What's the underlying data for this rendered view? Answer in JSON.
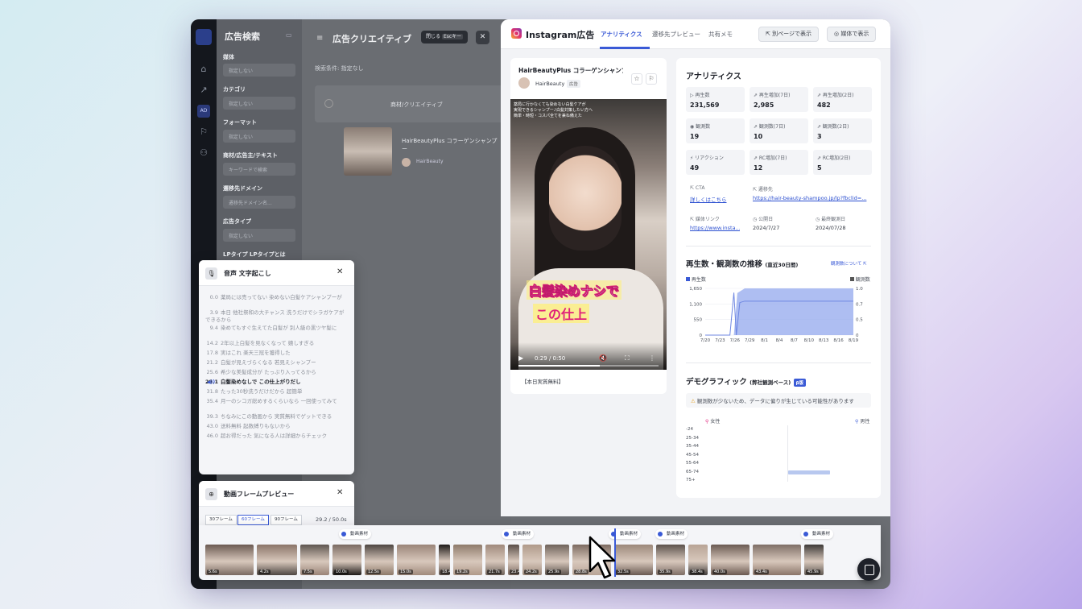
{
  "background_window": {
    "filter_title": "広告検索",
    "filters": [
      {
        "label": "媒体",
        "value": "指定しない"
      },
      {
        "label": "カテゴリ",
        "value": "指定しない"
      },
      {
        "label": "フォーマット",
        "value": "指定しない"
      },
      {
        "label": "商材/広告主/テキスト",
        "value": "キーワードで検索"
      },
      {
        "label": "遷移先ドメイン",
        "value": "遷移先ドメイン名..."
      },
      {
        "label": "広告タイプ",
        "value": "指定しない"
      },
      {
        "label": "LPタイプ  LPタイプとは",
        "value": ""
      }
    ],
    "main_title": "広告クリエイティブ",
    "search_condition": "検索条件:  指定なし",
    "table_header": "商材/クリエイティブ",
    "row_title": "HairBeautyPlus コラーゲンシャンプー",
    "row_account": "HairBeauty",
    "close_label": "閉じる",
    "esc_label": "Escキー"
  },
  "modal": {
    "title": "Instagram広告",
    "tabs": [
      "アナリティクス",
      "遷移先プレビュー",
      "共有メモ"
    ],
    "open_new_page": "別ページで表示",
    "open_in_media": "媒体で表示"
  },
  "post": {
    "title": "HairBeautyPlus コラーゲンシャンプー",
    "account": "HairBeauty",
    "badge": "広告",
    "overlay_text": "薬局に行かなくても染めない白髪ケアが\n実現できるシャンプー♪白髪対策したい方へ\n簡単・時短・コスパ全てを兼ね備えた",
    "caption_line1": "白髪染めナシで",
    "caption_line2": "この仕上",
    "time": "0:29 / 0:50",
    "progress_fraction": 0.58,
    "footer": "【本日実質無料】"
  },
  "analytics": {
    "heading": "アナリティクス",
    "stats": [
      {
        "label": "▷ 再生数",
        "value": "231,569"
      },
      {
        "label": "⇗ 再生増加(7日)",
        "value": "2,985"
      },
      {
        "label": "⇗ 再生増加(2日)",
        "value": "482"
      },
      {
        "label": "◉ 観測数",
        "value": "19"
      },
      {
        "label": "⇗ 観測数(7日)",
        "value": "10"
      },
      {
        "label": "⇗ 観測数(2日)",
        "value": "3"
      },
      {
        "label": "⚡ リアクション",
        "value": "49"
      },
      {
        "label": "⇗ RC増加(7日)",
        "value": "12"
      },
      {
        "label": "⇗ RC増加(2日)",
        "value": "5"
      }
    ],
    "info": [
      {
        "label": "⇱ CTA",
        "value": "詳しくはこちら",
        "link": true
      },
      {
        "label": "⇱ 遷移先",
        "value": "https://hair-beauty-shampoo.jp/lp?fbclid=...",
        "link": true
      },
      {
        "label": "⇱ 媒体リンク",
        "value": "https://www.insta...",
        "link": true
      },
      {
        "label": "◷ 公開日",
        "value": "2024/7/27",
        "link": false
      },
      {
        "label": "◷ 最終観測日",
        "value": "2024/07/28",
        "link": false
      }
    ],
    "trend_title": "再生数・観測数の推移",
    "trend_sub": "(直近30日間)",
    "trend_link": "観測数について ⇱",
    "demo_title": "デモグラフィック",
    "demo_sub": "(弊社観測ベース)",
    "demo_badge": "β版",
    "demo_warning": "観測数が少ないため、データに偏りが生じている可能性があります",
    "female_label": "女性",
    "male_label": "男性",
    "ages": [
      "-24",
      "25-34",
      "35-44",
      "45-54",
      "55-64",
      "65-74",
      "75+"
    ],
    "demo_female": [
      0,
      0,
      0,
      0,
      0,
      0,
      0
    ],
    "demo_male": [
      0,
      0,
      0,
      0,
      0,
      1,
      0
    ]
  },
  "chart_data": {
    "type": "area",
    "x": [
      "7/20",
      "7/23",
      "7/26",
      "7/29",
      "8/1",
      "8/4",
      "8/7",
      "8/10",
      "8/13",
      "8/16",
      "8/19"
    ],
    "series": [
      {
        "name": "再生数",
        "axis": "left",
        "points": [
          [
            0,
            0
          ],
          [
            5,
            0
          ],
          [
            5.8,
            1500
          ],
          [
            6.3,
            0
          ],
          [
            7,
            1150
          ],
          [
            8,
            1200
          ],
          [
            30,
            1200
          ]
        ]
      },
      {
        "name": "観測数",
        "axis": "right",
        "points": [
          [
            0,
            0
          ],
          [
            5.8,
            0
          ],
          [
            6.5,
            0.9
          ],
          [
            8,
            1
          ],
          [
            30,
            1
          ]
        ]
      }
    ],
    "y_left_ticks": [
      "1,650",
      "1,100",
      "550",
      "0"
    ],
    "y_right_ticks": [
      "1.0",
      "0.7",
      "0.5",
      "0"
    ],
    "ylim_left": [
      0,
      1650
    ],
    "ylim_right": [
      0,
      1
    ],
    "grid": true,
    "legend": "top"
  },
  "transcript": {
    "title": "音声 文字起こし",
    "lines": [
      {
        "t": "0.0",
        "text": "薬局には売ってない 染めない白髪ケアシャンプーが"
      },
      {
        "t": "3.9",
        "text": "本日 他社祭和の大チャンス 洗うだけでシラガケアができるから"
      },
      {
        "t": "9.4",
        "text": "染めてもすぐ生えてた白髪が 別人級の黒ツヤ髪に"
      },
      {
        "t": "14.2",
        "text": "2年以上白髪を見なくなって 嬉しすぎる"
      },
      {
        "t": "17.8",
        "text": "実はこれ 楽天三冠を獲得した"
      },
      {
        "t": "21.2",
        "text": "白髪が見えづらくなる 若見えシャンプー"
      },
      {
        "t": "25.6",
        "text": "希少な美髪成分が たっぷり入ってるから"
      },
      {
        "t": "29.1",
        "text": "白髪染めなしで この仕上がりだし",
        "current": true
      },
      {
        "t": "31.8",
        "text": "たった30秒洗うだけだから 超簡単"
      },
      {
        "t": "35.4",
        "text": "月一のシコガ総めするくらいなら 一回使ってみて"
      },
      {
        "t": "39.3",
        "text": "ちなみにこの動画から 実質無料でゲットできる"
      },
      {
        "t": "43.0",
        "text": "送料無料 起数縛りもないから"
      },
      {
        "t": "46.0",
        "text": "超お得だった 気になる人は詳細からチェック"
      }
    ]
  },
  "frames": {
    "title": "動画フレームプレビュー",
    "options": [
      "30フレーム",
      "60フレーム",
      "90フレーム"
    ],
    "selected": "60フレーム",
    "count": "29.2 / 50.0s",
    "material_label": "動画素材",
    "thumb_times": [
      "5.6s",
      "4.2s",
      "7.5s",
      "10.0s",
      "12.5s",
      "15.0s",
      "18.4s",
      "19.2s",
      "21.7s",
      "23.4s",
      "24.2s",
      "25.9s",
      "28.8s",
      "32.5s",
      "35.9s",
      "38.4s",
      "40.0s",
      "43.4s",
      "45.9s"
    ]
  },
  "colors": {
    "accent": "#3a5ad6",
    "chart_area": "#93a8ee",
    "chart_line": "#6f87e2"
  }
}
